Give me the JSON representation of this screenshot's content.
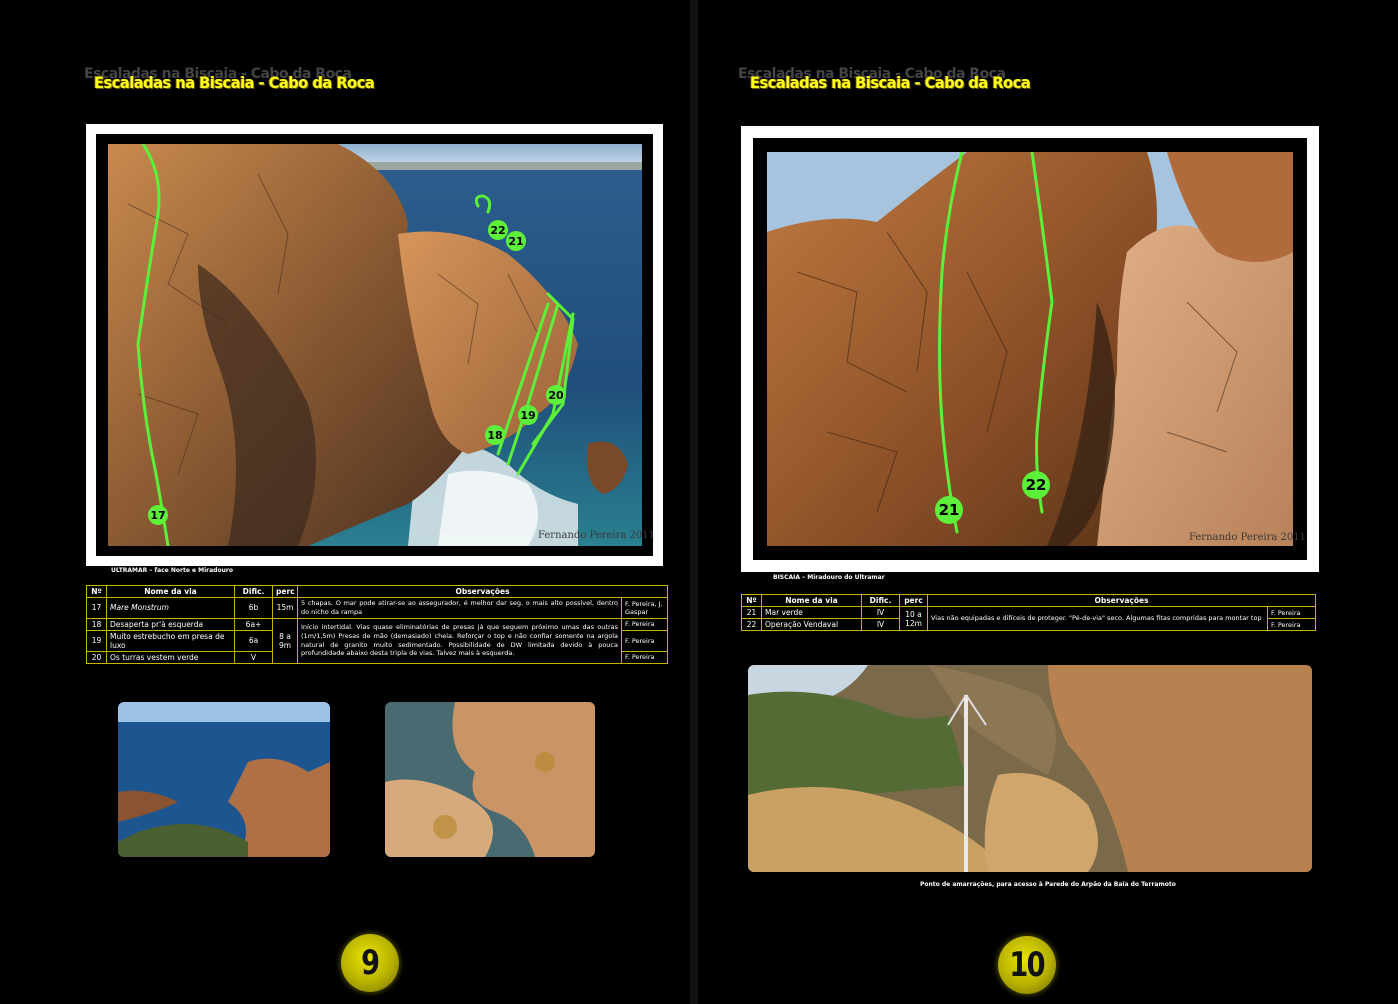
{
  "left_page": {
    "header_title": "Escaladas na Biscaia - Cabo da Roca",
    "photo_signature": "Fernando Pereira 2011",
    "photo_route_labels": [
      "17",
      "18",
      "19",
      "20",
      "21",
      "22"
    ],
    "photo_caption": "ULTRAMAR – face Norte e Miradouro",
    "table": {
      "headers": [
        "Nº",
        "Nome da via",
        "Dific.",
        "perc",
        "Observações"
      ],
      "rows": [
        {
          "num": "17",
          "name": "Mare Monstrum",
          "grade": "6b",
          "length": "15m",
          "obs": "5 chapas. O mar pode atirar-se ao assegurador, é melhor dar seg. o mais alto possível, dentro do nicho da rampa",
          "author": "F. Pereira, J. Gaspar"
        },
        {
          "num": "18",
          "name": "Desaperta pr'à esquerda",
          "grade": "6a+",
          "author": "F. Pereira"
        },
        {
          "num": "19",
          "name": "Muito estrebucho em presa de luxo",
          "grade": "6a",
          "author": "F. Pereira"
        },
        {
          "num": "20",
          "name": "Os turras vestem verde",
          "grade": "V",
          "author": "F. Pereira"
        }
      ],
      "group_length": "8 a 9m",
      "group_obs": "Início intertidal. Vias quase eliminatórias de presas já que seguem próximo umas das outras (1m/1,5m) Presas de mão (demasiado) cheia. Reforçar o top e não confiar somente na argola natural de granito muito sedimentado. Possibilidade de DW limitada devido à pouca profundidade abaixo desta tripla de vias. Talvez mais à esquerda."
    },
    "page_number": "9"
  },
  "right_page": {
    "header_title": "Escaladas na Biscaia - Cabo da Roca",
    "photo_signature": "Fernando Pereira 2011",
    "photo_route_labels": [
      "21",
      "22"
    ],
    "photo_caption": "BISCAIA – Miradouro do Ultramar",
    "table": {
      "headers": [
        "Nº",
        "Nome da via",
        "Dific.",
        "perc",
        "Observações"
      ],
      "rows": [
        {
          "num": "21",
          "name": "Mar verde",
          "grade": "IV",
          "author": "F. Pereira"
        },
        {
          "num": "22",
          "name": "Operação Vendaval",
          "grade": "IV",
          "author": "F. Pereira"
        }
      ],
      "group_length": "10 a 12m",
      "group_obs": "Vias não equipadas e difíceis de proteger. \"Pé-de-via\" seco. Algumas fitas compridas para montar top"
    },
    "bottom_caption": "Ponto de amarrações, para acesso à Parede do Arpão da Baía do Terramoto",
    "page_number": "10"
  },
  "colors": {
    "title_yellow": "#ffff1a",
    "table_border": "#c8b400",
    "route_line_green": "#5cf03a",
    "background": "#000000"
  }
}
